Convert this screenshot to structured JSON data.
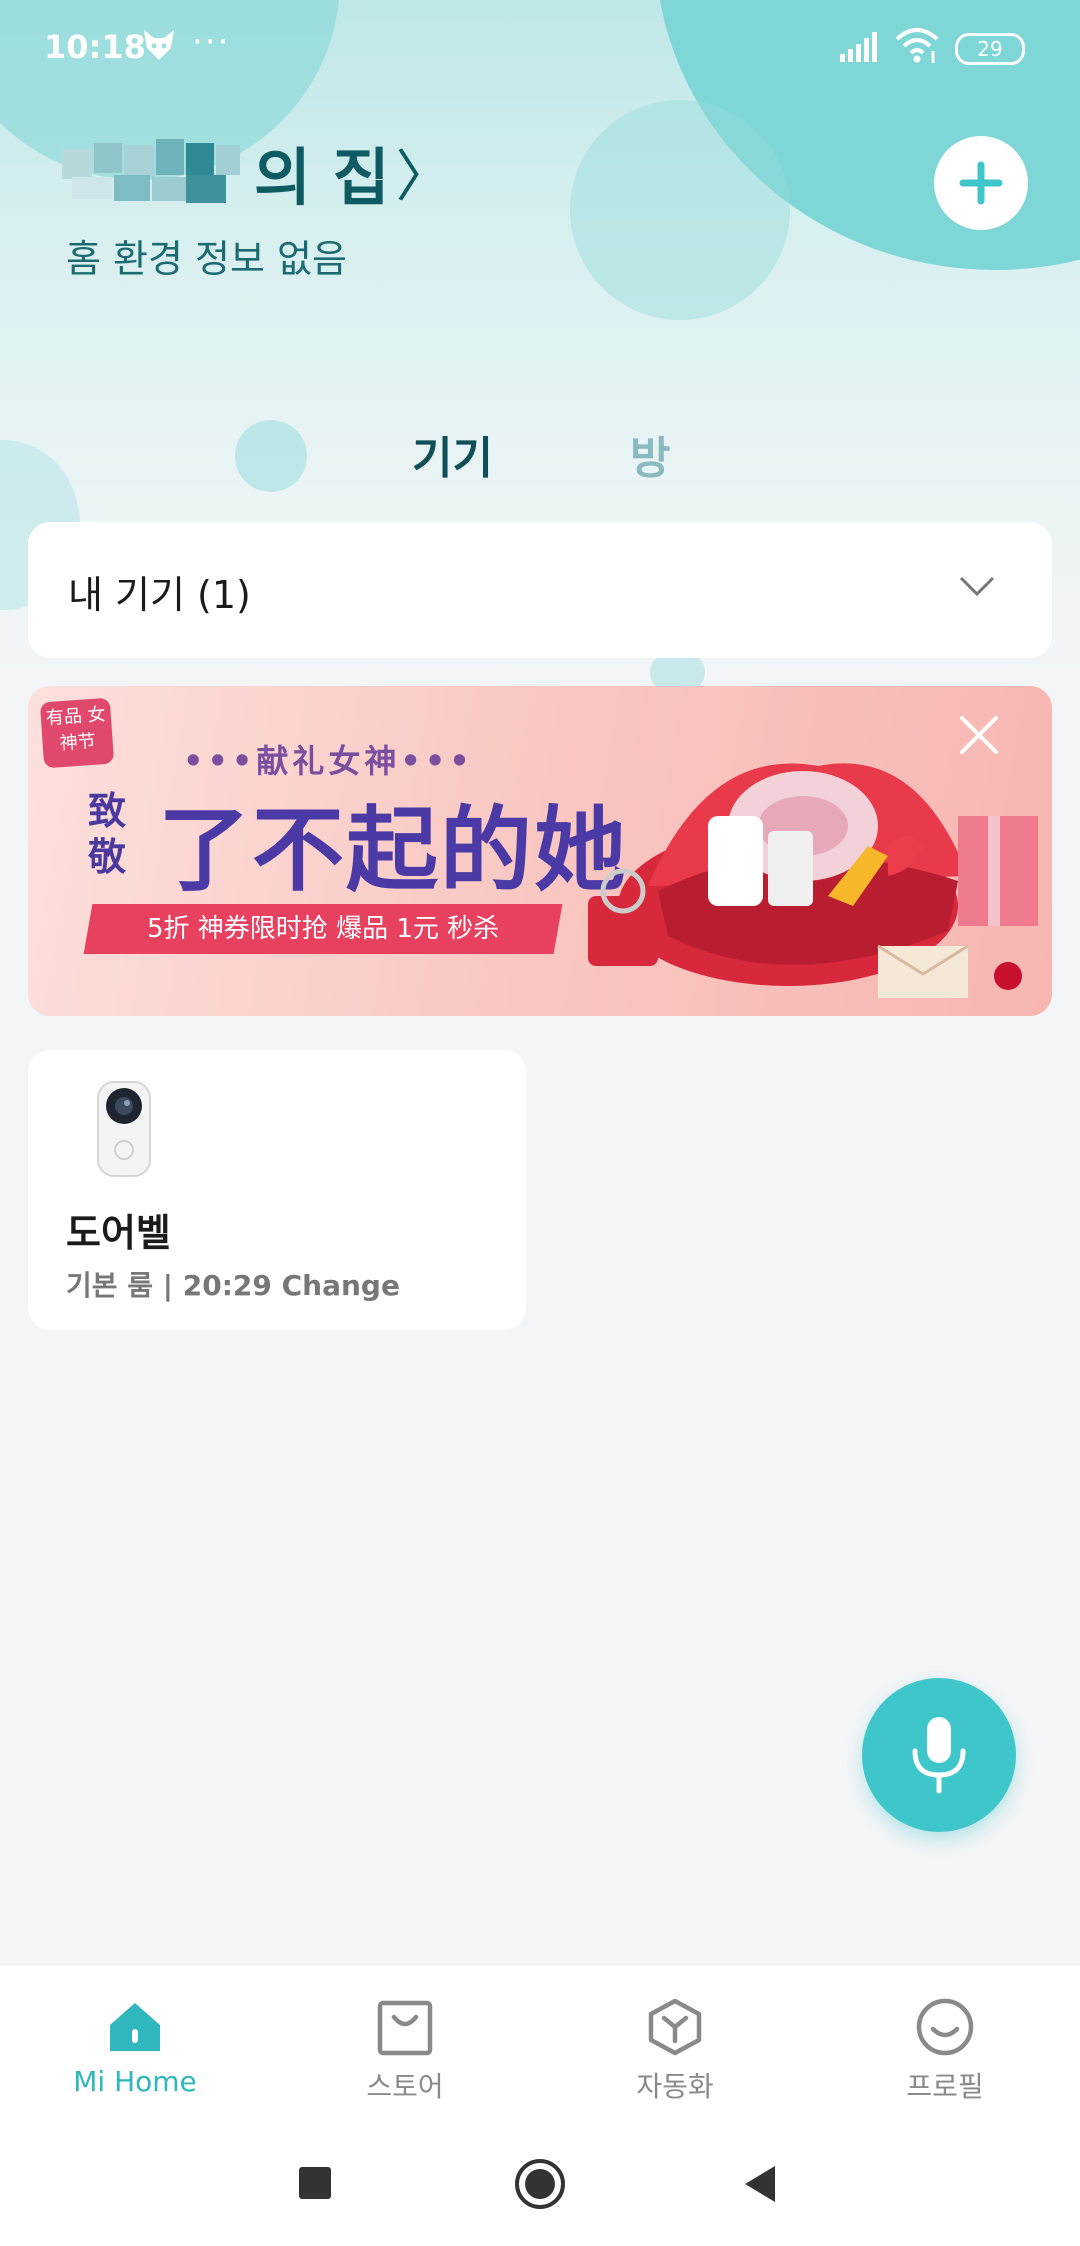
{
  "status_bar": {
    "time": "10:18",
    "dots": "···",
    "battery": "29"
  },
  "header": {
    "home_name": "의 집",
    "home_chevron": "〉",
    "home_subtitle": "홈 환경 정보 없음",
    "add_icon": "plus-icon"
  },
  "tabs": [
    {
      "label": "기기",
      "active": true
    },
    {
      "label": "방",
      "active": false
    }
  ],
  "device_dropdown": {
    "label": "내 기기 (1)"
  },
  "banner": {
    "badge": "有品 女神节",
    "subtitle": "•••献礼女神•••",
    "title_small": "致敬",
    "title": "了不起的她",
    "ribbon": "5折 神券限时抢  爆品 1元 秒杀"
  },
  "devices": [
    {
      "name": "도어벨",
      "status": "기본 룸 | 20:29 Change"
    }
  ],
  "bottom_nav": [
    {
      "label": "Mi Home",
      "icon": "home-icon",
      "active": true
    },
    {
      "label": "스토어",
      "icon": "store-bag-icon",
      "active": false
    },
    {
      "label": "자동화",
      "icon": "automation-icon",
      "active": false
    },
    {
      "label": "프로필",
      "icon": "profile-icon",
      "active": false
    }
  ],
  "colors": {
    "accent": "#2fb7bd",
    "header_text": "#0f5b63",
    "mic_button": "#3fc6cb"
  }
}
